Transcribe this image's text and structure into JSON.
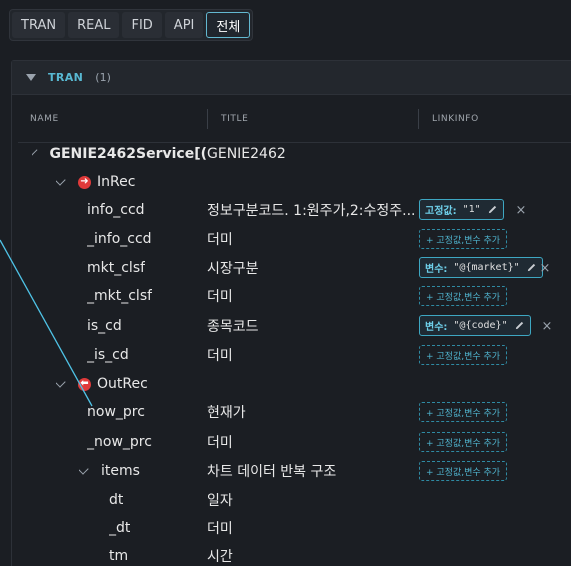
{
  "tabs": [
    "TRAN",
    "REAL",
    "FID",
    "API",
    "전체"
  ],
  "section": {
    "title": "TRAN",
    "count": "(1)"
  },
  "columns": {
    "name": "NAME",
    "title": "TITLE",
    "linkinfo": "LINKINFO"
  },
  "rows": {
    "service": {
      "name": "GENIE2462Service[(",
      "title": "GENIE2462"
    },
    "inrec": {
      "name": "InRec"
    },
    "info_ccd": {
      "name": "info_ccd",
      "title": "정보구분코드. 1:원주가,2:수정주...",
      "chip_key": "고정값:",
      "chip_value": "\"1\""
    },
    "_info_ccd": {
      "name": "_info_ccd",
      "title": "더미",
      "add_label": "+ 고정값,변수 추가"
    },
    "mkt_clsf": {
      "name": "mkt_clsf",
      "title": "시장구분",
      "chip_key": "변수:",
      "chip_value": "\"@{market}\""
    },
    "_mkt_clsf": {
      "name": "_mkt_clsf",
      "title": "더미",
      "add_label": "+ 고정값,변수 추가"
    },
    "is_cd": {
      "name": "is_cd",
      "title": "종목코드",
      "chip_key": "변수:",
      "chip_value": "\"@{code}\""
    },
    "_is_cd": {
      "name": "_is_cd",
      "title": "더미",
      "add_label": "+ 고정값,변수 추가"
    },
    "outrec": {
      "name": "OutRec"
    },
    "now_prc": {
      "name": "now_prc",
      "title": "현재가",
      "add_label": "+ 고정값,변수 추가"
    },
    "_now_prc": {
      "name": "_now_prc",
      "title": "더미",
      "add_label": "+ 고정값,변수 추가"
    },
    "items": {
      "name": "items",
      "title": "차트 데이터 반복 구조",
      "add_label": "+ 고정값,변수 추가"
    },
    "dt": {
      "name": "dt",
      "title": "일자"
    },
    "_dt": {
      "name": "_dt",
      "title": "더미"
    },
    "tm": {
      "name": "tm",
      "title": "시간"
    }
  },
  "icons": {
    "remove": "close-icon",
    "edit": "pencil-icon",
    "rec": "arrow-right-circle-icon"
  },
  "colors": {
    "accent": "#4fb3cd",
    "rec_icon": "#e03a3a",
    "background": "#1b1e23"
  }
}
